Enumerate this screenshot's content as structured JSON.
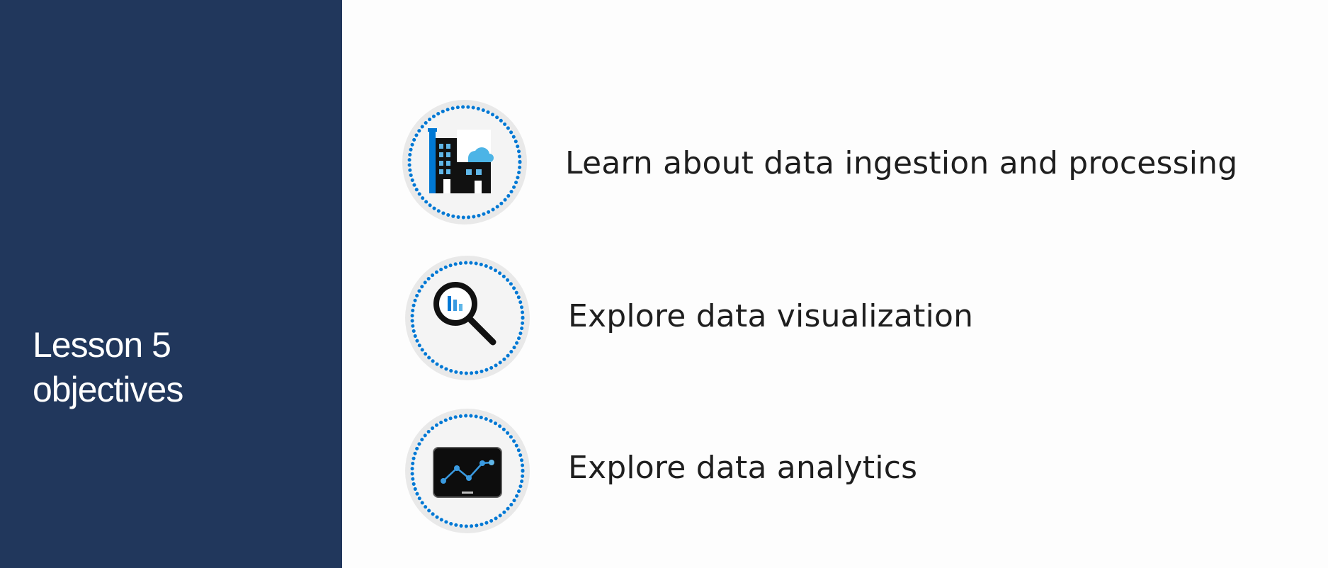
{
  "slide": {
    "title_line1": "Lesson 5",
    "title_line2": "objectives"
  },
  "objectives": [
    {
      "text": "Learn about data ingestion and processing",
      "icon": "factory-building-icon"
    },
    {
      "text": "Explore data visualization",
      "icon": "magnifier-bar-chart-icon"
    },
    {
      "text": "Explore data analytics",
      "icon": "monitor-line-chart-icon"
    }
  ],
  "colors": {
    "panel": "#21375c",
    "accent": "#0078d4",
    "circle_fill": "#eeeeee",
    "text": "#1e1e1e"
  }
}
